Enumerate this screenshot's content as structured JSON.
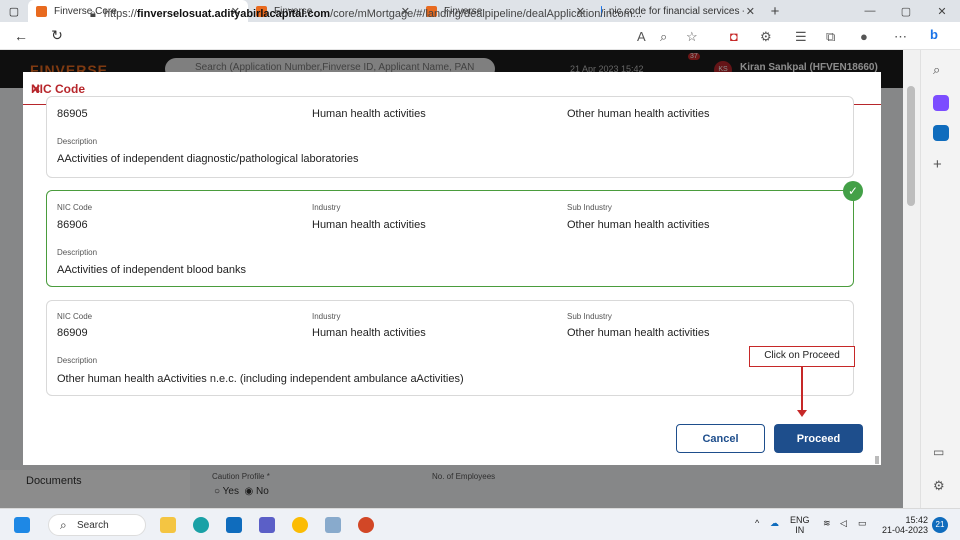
{
  "browser": {
    "tabs": [
      {
        "title": "Finverse Core",
        "active": true,
        "favicon_color": "#e86a1f"
      },
      {
        "title": "Finverse",
        "active": false,
        "favicon_color": "#e86a1f"
      },
      {
        "title": "Finverse",
        "active": false,
        "favicon_color": "#e86a1f"
      },
      {
        "title": "nic code for financial services - S",
        "active": false,
        "favicon_color": "#1a73e8"
      }
    ],
    "url_prefix": "https://",
    "url_host": "finverselosuat.adityabirlacapital.com",
    "url_path": "/core/mMortgage/#/landing/dealpipeline/dealApplication/incom..."
  },
  "app": {
    "logo": "FINVERSE",
    "search_placeholder": "Search (Application Number,Finverse ID, Applicant Name, PAN Number)",
    "date": "21 Apr 2023 15:42",
    "notif_count": "37",
    "user_initials": "KS",
    "user": "Kiran Sankpal (HFVEN18660)",
    "sidebar_docs": "Documents",
    "caution_label": "Caution Profile *",
    "yes": "Yes",
    "no": "No",
    "employees_label": "No. of Employees"
  },
  "modal": {
    "title": "NIC Code",
    "labels": {
      "nic": "NIC Code",
      "industry": "Industry",
      "sub": "Sub Industry",
      "desc": "Description"
    },
    "cards": [
      {
        "code": "86905",
        "industry": "Human health activities",
        "sub": "Other human health activities",
        "desc": "AActivities of independent diagnostic/pathological laboratories",
        "selected": false
      },
      {
        "code": "86906",
        "industry": "Human health activities",
        "sub": "Other human health activities",
        "desc": "AActivities of independent blood banks",
        "selected": true
      },
      {
        "code": "86909",
        "industry": "Human health activities",
        "sub": "Other human health activities",
        "desc": "Other human health aActivities n.e.c. (including independent ambulance aActivities)",
        "selected": false
      }
    ],
    "callout": "Click on Proceed",
    "cancel": "Cancel",
    "proceed": "Proceed"
  },
  "taskbar": {
    "search": "Search",
    "lang1": "ENG",
    "lang2": "IN",
    "time": "15:42",
    "date": "21-04-2023",
    "badge": "21"
  }
}
